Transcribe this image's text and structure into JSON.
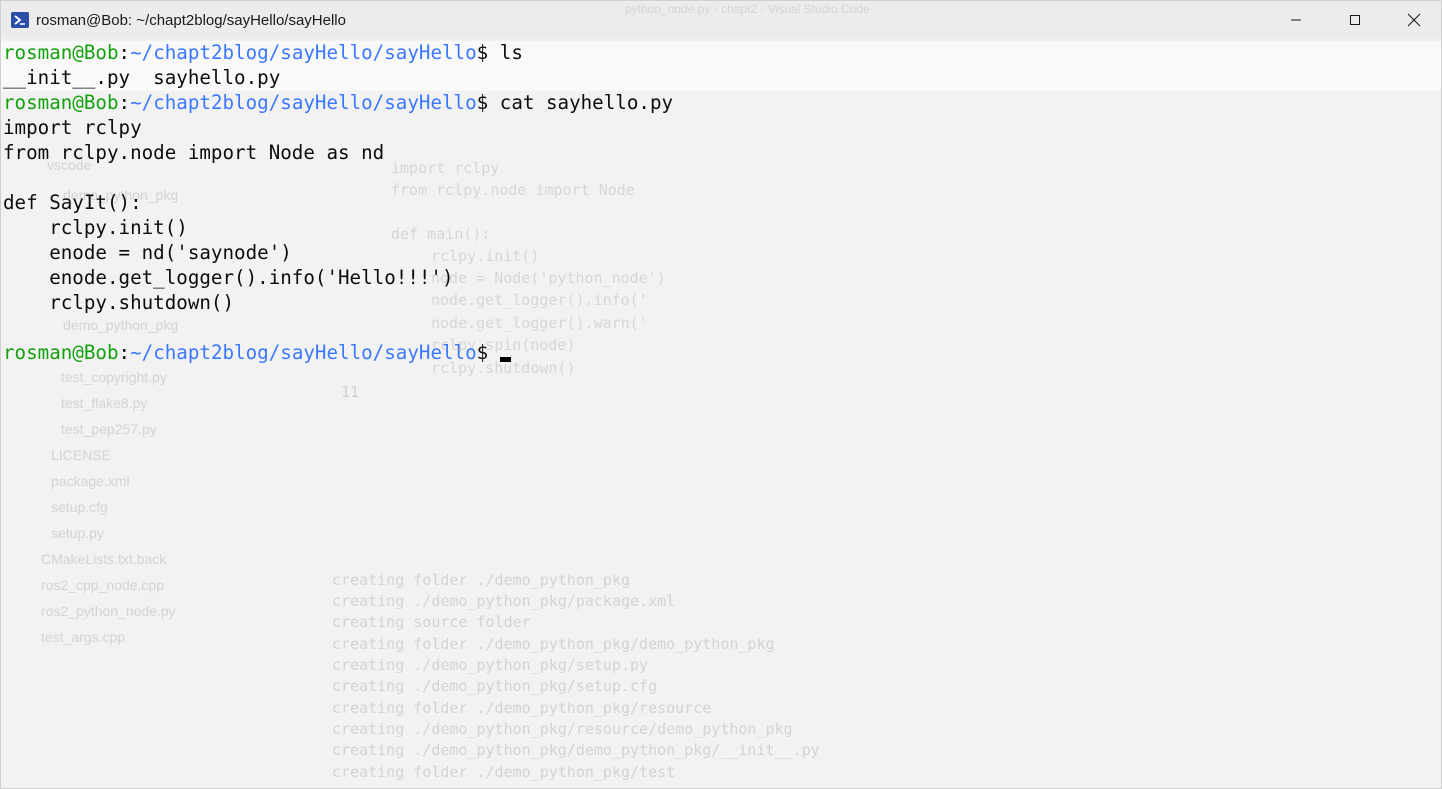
{
  "window": {
    "title": "rosman@Bob: ~/chapt2blog/sayHello/sayHello",
    "icon": "powershell-icon"
  },
  "controls": {
    "minimize_icon": "minimize-icon",
    "maximize_icon": "maximize-icon",
    "close_icon": "close-icon"
  },
  "terminal": {
    "prompt_user": "rosman@Bob",
    "prompt_sep": ":",
    "prompt_path": "~/chapt2blog/sayHello/sayHello",
    "prompt_symbol": "$ ",
    "cmd1": "ls",
    "ls_output": "__init__.py  sayhello.py",
    "cmd2": "cat sayhello.py",
    "file_lines": [
      "import rclpy",
      "from rclpy.node import Node as nd",
      "",
      "def SayIt():",
      "    rclpy.init()",
      "    enode = nd('saynode')",
      "    enode.get_logger().info('Hello!!!')",
      "    rclpy.shutdown()"
    ]
  },
  "colors": {
    "prompt_user": "#13a10e",
    "prompt_path": "#3b78ff",
    "text": "#0c0c0c",
    "background": "#f2f2f2"
  }
}
